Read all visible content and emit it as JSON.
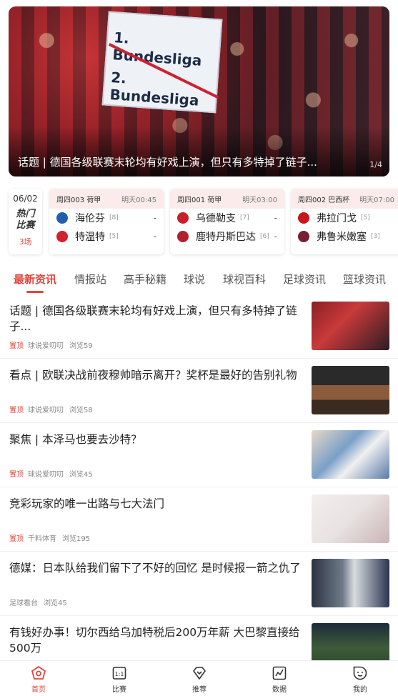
{
  "banner": {
    "caption": "话题 | 德国各级联赛末轮均有好戏上演，但只有多特掉了链子...",
    "counter": "1/4",
    "sign_line1": "1. Bundesliga",
    "sign_line2": "2. Bundesliga"
  },
  "hot": {
    "date": "06/02",
    "title_line1": "热门",
    "title_line2": "比赛",
    "count": "3场"
  },
  "matches": [
    {
      "league": "周四003 荷甲",
      "time": "明天00:45",
      "home": {
        "name": "海伦芬",
        "rank": "[8]",
        "score": "-",
        "color": "#1f5fb0"
      },
      "away": {
        "name": "特温特",
        "rank": "[5]",
        "score": "-",
        "color": "#d0222a"
      }
    },
    {
      "league": "周四001 荷甲",
      "time": "明天03:00",
      "home": {
        "name": "乌德勒支",
        "rank": "[7]",
        "score": "-",
        "color": "#c8202a"
      },
      "away": {
        "name": "鹿特丹斯巴达",
        "rank": "[6]",
        "score": "-",
        "color": "#b02030"
      }
    },
    {
      "league": "周四002 巴西杯",
      "time": "明天07:00",
      "home": {
        "name": "弗拉门戈",
        "rank": "[5]",
        "score": "-",
        "color": "#c8161e"
      },
      "away": {
        "name": "弗鲁米嫩塞",
        "rank": "[3]",
        "score": "-",
        "color": "#7a1f30"
      }
    }
  ],
  "tabs": [
    "最新资讯",
    "情报站",
    "高手秘籍",
    "球说",
    "球视百科",
    "足球资讯",
    "篮球资讯"
  ],
  "news": [
    {
      "title": "话题 | 德国各级联赛末轮均有好戏上演，但只有多特掉了链子...",
      "pin": "置顶",
      "source": "球说爱叨叨",
      "views": "浏览59"
    },
    {
      "title": "看点 | 欧联决战前夜穆帅暗示离开？奖杯是最好的告别礼物",
      "pin": "置顶",
      "source": "球说爱叨叨",
      "views": "浏览58"
    },
    {
      "title": "聚焦 | 本泽马也要去沙特？",
      "pin": "置顶",
      "source": "球说爱叨叨",
      "views": "浏览45"
    },
    {
      "title": "竞彩玩家的唯一出路与七大法门",
      "pin": "置顶",
      "source": "千料体育",
      "views": "浏览195"
    },
    {
      "title": "德媒：日本队给我们留下了不好的回忆 是时候报一箭之仇了",
      "pin": "",
      "source": "足球看台",
      "views": "浏览45"
    },
    {
      "title": "有钱好办事！切尔西给乌加特税后200万年薪 大巴黎直接给500万",
      "pin": "",
      "source": "",
      "views": ""
    }
  ],
  "bottom_nav": [
    {
      "label": "首页",
      "icon": "home-icon",
      "active": true
    },
    {
      "label": "比赛",
      "icon": "scoreboard-icon",
      "active": false
    },
    {
      "label": "推荐",
      "icon": "diamond-icon",
      "active": false
    },
    {
      "label": "数据",
      "icon": "chart-icon",
      "active": false
    },
    {
      "label": "我的",
      "icon": "profile-face-icon",
      "active": false
    }
  ],
  "colors": {
    "accent": "#e2453c",
    "match_header": "#fbeceb"
  }
}
